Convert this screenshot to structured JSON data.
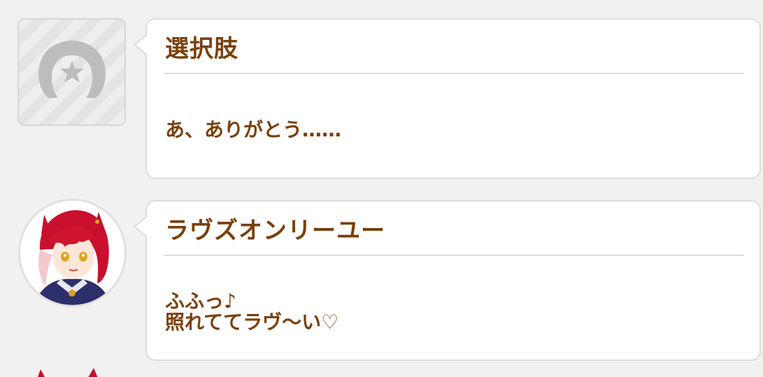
{
  "log": [
    {
      "speaker": "選択肢",
      "message": "あ、ありがとう……",
      "avatar_icon": "horseshoe-star-icon"
    },
    {
      "speaker": "ラヴズオンリーユー",
      "message": "ふふっ♪\n照れててラヴ〜い♡",
      "avatar_icon": "character-portrait"
    }
  ],
  "colors": {
    "text": "#7a3f0b",
    "bubble": "#ffffff",
    "border": "#dcdcdc",
    "background": "#f1f1f1",
    "hair": "#c8102e"
  }
}
